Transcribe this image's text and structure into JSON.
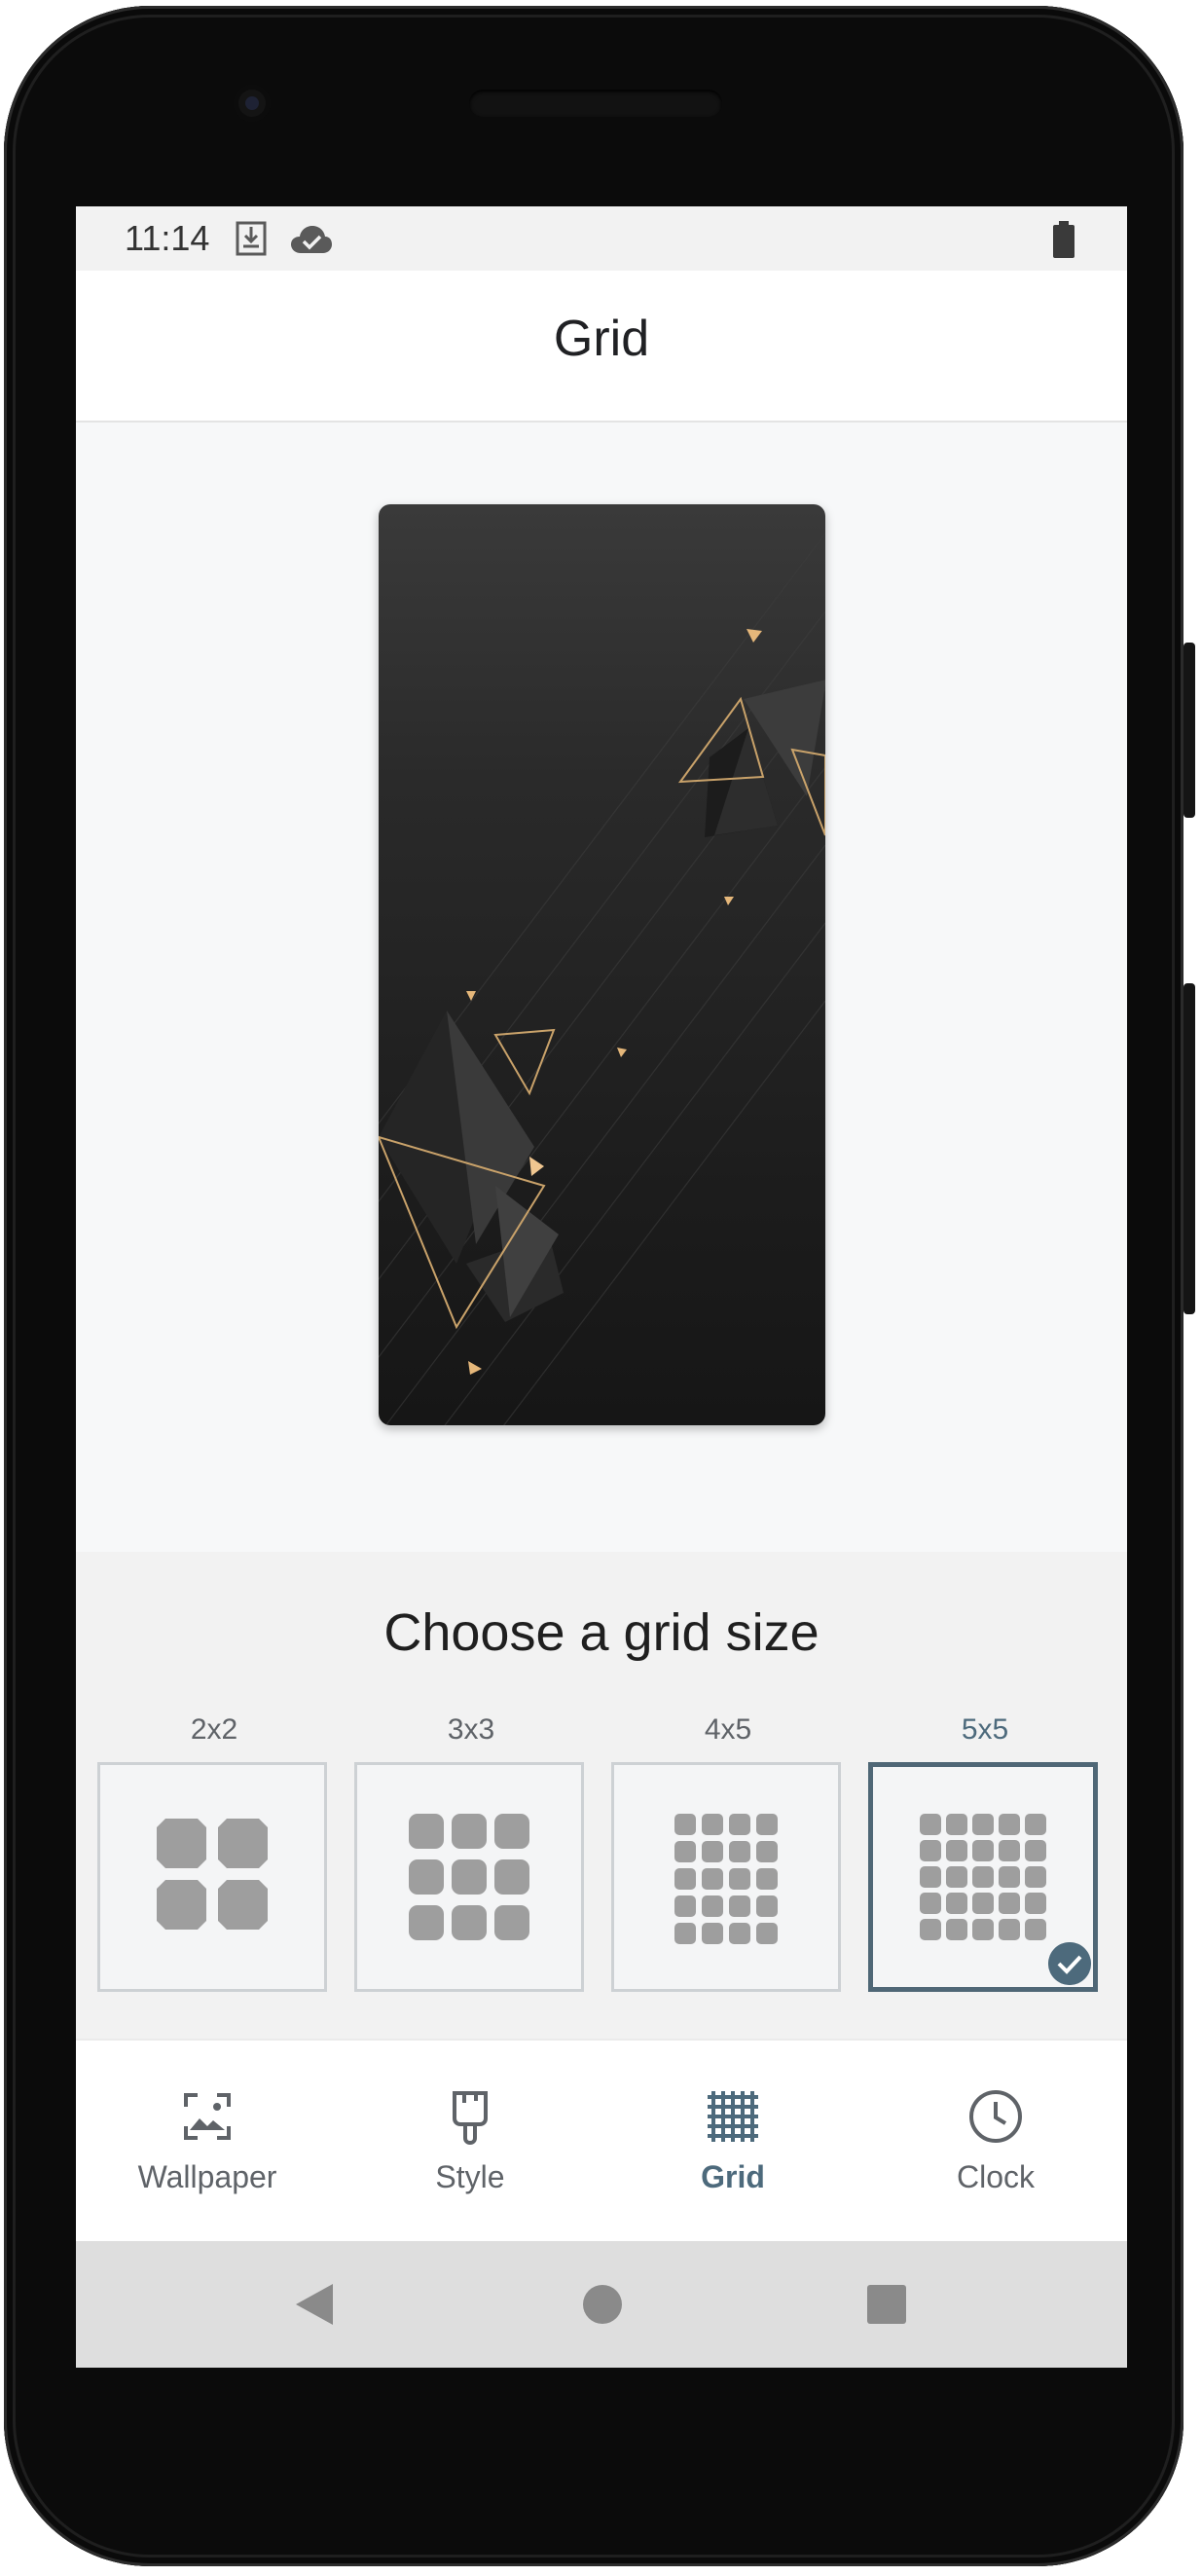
{
  "status_bar": {
    "time": "11:14",
    "icons": [
      "sd-card-download-icon",
      "cloud-done-icon",
      "battery-icon"
    ]
  },
  "app_bar": {
    "title": "Grid"
  },
  "preview": {
    "wallpaper": "dark geometric triangles wallpaper"
  },
  "grid_chooser": {
    "title": "Choose a grid size",
    "options": [
      {
        "label": "2x2",
        "cols": 2,
        "rows": 2,
        "selected": false
      },
      {
        "label": "3x3",
        "cols": 3,
        "rows": 3,
        "selected": false
      },
      {
        "label": "4x5",
        "cols": 4,
        "rows": 5,
        "selected": false
      },
      {
        "label": "5x5",
        "cols": 5,
        "rows": 5,
        "selected": true
      }
    ]
  },
  "bottom_nav": {
    "items": [
      {
        "label": "Wallpaper",
        "icon": "wallpaper-icon",
        "active": false
      },
      {
        "label": "Style",
        "icon": "paintbrush-icon",
        "active": false
      },
      {
        "label": "Grid",
        "icon": "grid-icon",
        "active": true
      },
      {
        "label": "Clock",
        "icon": "clock-icon",
        "active": false
      }
    ]
  },
  "system_nav": {
    "buttons": [
      "back-button",
      "home-button",
      "recents-button"
    ]
  },
  "colors": {
    "accent": "#4d6a7c",
    "tile_border": "#cdd1d4",
    "app_icon_gray": "#9e9e9e",
    "wallpaper_gold": "#c9a26a"
  }
}
